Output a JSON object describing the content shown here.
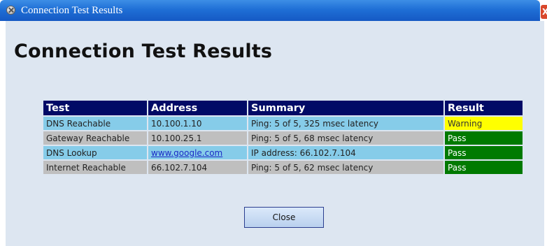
{
  "window": {
    "title": "Connection Test Results",
    "close_glyph": "X"
  },
  "main": {
    "heading": "Connection Test Results",
    "table": {
      "columns": [
        "Test",
        "Address",
        "Summary",
        "Result"
      ],
      "rows": [
        {
          "test": "DNS Reachable",
          "address": "10.100.1.10",
          "summary": "Ping: 5 of 5, 325 msec latency",
          "result": "Warning"
        },
        {
          "test": "Gateway Reachable",
          "address": "10.100.25.1",
          "summary": "Ping: 5 of 5, 68 msec latency",
          "result": "Pass"
        },
        {
          "test": "DNS Lookup",
          "address": "www.google.com",
          "summary": "IP address: 66.102.7.104",
          "result": "Pass"
        },
        {
          "test": "Internet Reachable",
          "address": "66.102.7.104",
          "summary": "Ping: 5 of 5, 62 msec latency",
          "result": "Pass"
        }
      ]
    },
    "close_label": "Close"
  },
  "colors": {
    "header_bg": "#010a66",
    "row_blue": "#86cce9",
    "row_gray": "#bfbfbf",
    "warning": "#ffff00",
    "pass": "#007a00",
    "content_bg": "#dde6f1"
  },
  "icons": {
    "title_icon": "network-test-icon"
  }
}
